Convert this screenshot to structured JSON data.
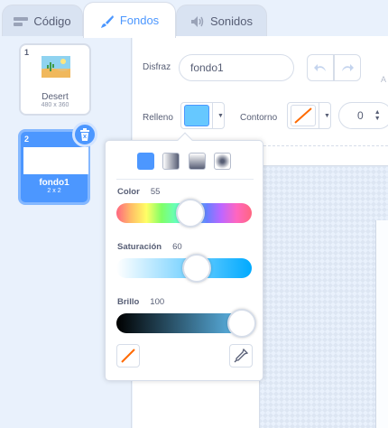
{
  "tabs": [
    {
      "label": "Código",
      "icon": "code-icon"
    },
    {
      "label": "Fondos",
      "icon": "brush-icon"
    },
    {
      "label": "Sonidos",
      "icon": "speaker-icon"
    }
  ],
  "costumes": [
    {
      "number": "1",
      "name": "Desert",
      "size": "480 x 360"
    },
    {
      "number": "2",
      "name": "fondo1",
      "size": "2 x 2",
      "selected": true
    }
  ],
  "editor": {
    "costume_label": "Disfraz",
    "costume_name": "fondo1",
    "fill_label": "Relleno",
    "outline_label": "Contorno",
    "outline_width": "0",
    "overflow_letter": "A"
  },
  "fill_color_hex": "#66c8ff",
  "accent": "#4c97ff",
  "picker": {
    "color_label": "Color",
    "color_value": "55",
    "saturation_label": "Saturación",
    "saturation_value": "60",
    "brightness_label": "Brillo",
    "brightness_value": "100"
  }
}
